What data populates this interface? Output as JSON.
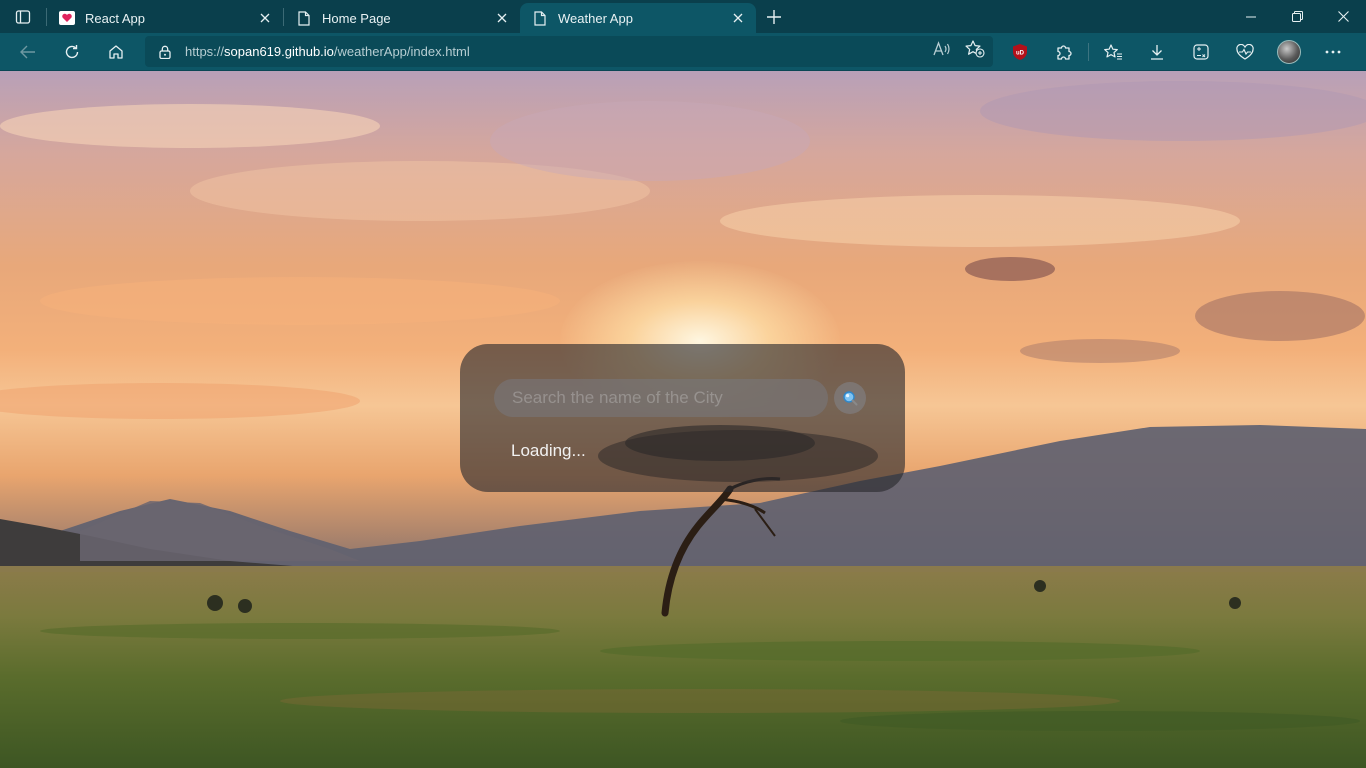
{
  "browser": {
    "tabs": [
      {
        "title": "React App",
        "icon": "heart-icon",
        "active": false
      },
      {
        "title": "Home Page",
        "icon": "page-icon",
        "active": false
      },
      {
        "title": "Weather App",
        "icon": "page-icon",
        "active": true
      }
    ],
    "address": {
      "scheme": "https://",
      "host": "sopan619.github.io",
      "path": "/weatherApp/index.html"
    },
    "colors": {
      "tabstrip": "#0a3f4c",
      "toolbar": "#0d5666",
      "address_field": "#0a4a58"
    }
  },
  "weather": {
    "search": {
      "placeholder": "Search the name of the City",
      "value": ""
    },
    "status_text": "Loading..."
  }
}
